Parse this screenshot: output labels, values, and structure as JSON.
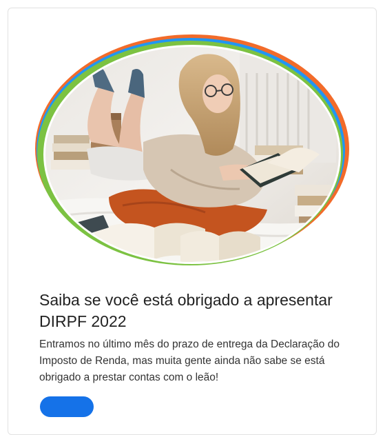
{
  "article": {
    "title": "Saiba se você está obrigado a apresentar DIRPF 2022",
    "description": "Entramos no último mês do prazo de entrega da Declaração do Imposto de Renda, mas muita gente ainda não sabe se está obrigado a prestar contas com o leão!",
    "button_label": ""
  },
  "colors": {
    "accent_blue": "#1572e8",
    "ring_orange": "#f26b2a",
    "ring_blue": "#2196f3",
    "ring_green": "#7cc242"
  }
}
